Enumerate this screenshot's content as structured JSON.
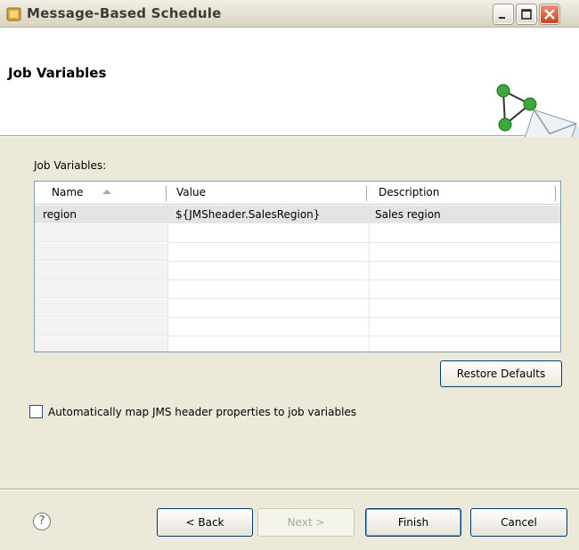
{
  "window": {
    "title": "Message-Based Schedule"
  },
  "banner": {
    "heading": "Job Variables"
  },
  "group_label": "Job Variables:",
  "table": {
    "columns": [
      "Name",
      "Value",
      "Description"
    ],
    "sort_column": "Name",
    "rows": [
      {
        "name": "region",
        "value": "${JMSheader.SalesRegion}",
        "description": "Sales region"
      }
    ]
  },
  "restore_defaults_label": "Restore Defaults",
  "checkbox": {
    "label": "Automatically map JMS header properties to job variables",
    "checked": false
  },
  "footer": {
    "help_icon": "?",
    "back_label": "< Back",
    "next_label": "Next >",
    "finish_label": "Finish",
    "cancel_label": "Cancel"
  }
}
